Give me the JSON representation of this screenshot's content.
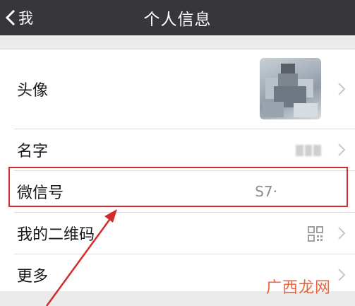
{
  "navbar": {
    "back_label": "我",
    "title": "个人信息"
  },
  "rows": [
    {
      "label": "头像"
    },
    {
      "label": "名字"
    },
    {
      "label": "微信号",
      "value": "S7·"
    },
    {
      "label": "我的二维码"
    },
    {
      "label": "更多"
    }
  ],
  "colors": {
    "navbar_bg": "#37373b",
    "highlight": "#d22b2b",
    "watermark": "#e8542a"
  },
  "watermark": "广西龙网",
  "icons": [
    "chevron-left-icon",
    "chevron-right-icon",
    "qr-code-icon"
  ]
}
